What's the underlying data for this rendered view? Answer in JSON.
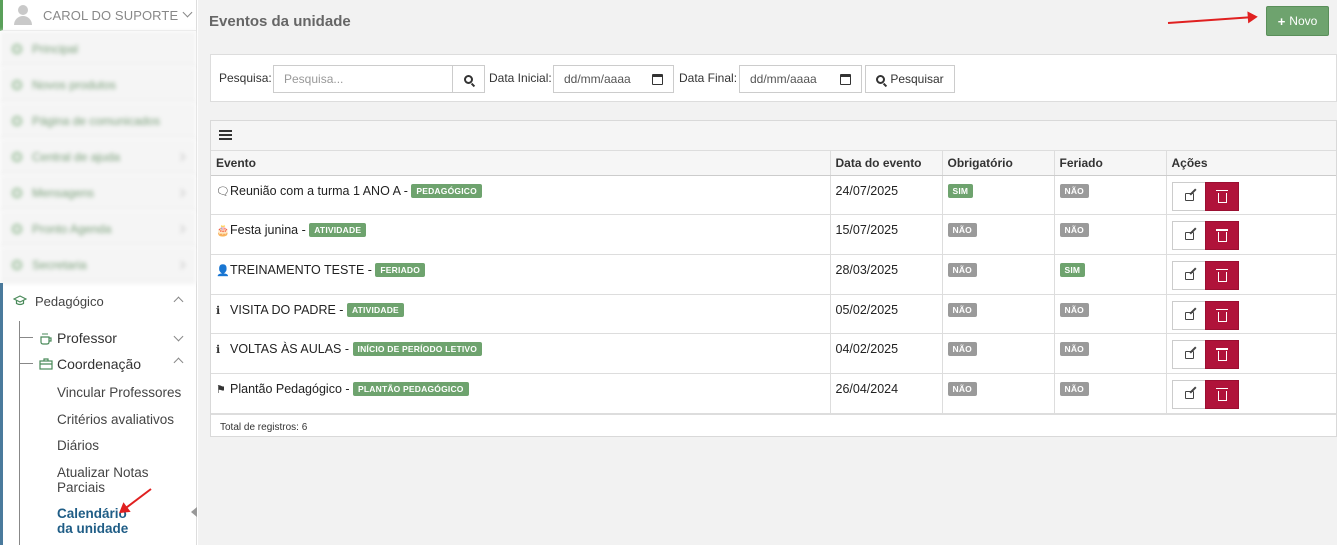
{
  "sidebar": {
    "user_name": "CAROL DO SUPORTE",
    "blurred_items": [
      "Principal",
      "Novos produtos",
      "Página de comunicados",
      "Central de ajuda",
      "Mensagens",
      "Pronto Agenda",
      "Secretaria"
    ],
    "pedagogico_label": "Pedagógico",
    "professor_label": "Professor",
    "coordenacao_label": "Coordenação",
    "links": [
      "Vincular Professores",
      "Critérios avaliativos",
      "Diários",
      "Atualizar Notas Parciais",
      "Calendário da unidade"
    ]
  },
  "header": {
    "title": "Eventos da unidade",
    "new_button": "Novo"
  },
  "search": {
    "label": "Pesquisa:",
    "placeholder": "Pesquisa...",
    "start_label": "Data Inicial:",
    "start_value": "dd/mm/aaaa",
    "end_label": "Data Final:",
    "end_value": "dd/mm/aaaa",
    "button": "Pesquisar"
  },
  "table": {
    "columns": [
      "Evento",
      "Data do evento",
      "Obrigatório",
      "Feriado",
      "Ações"
    ],
    "rows": [
      {
        "icon": "comment-icon",
        "title": "Reunião com a turma 1 ANO A -",
        "category": "PEDAGÓGICO",
        "date": "24/07/2025",
        "obrigatorio": "SIM",
        "feriado": "NÃO"
      },
      {
        "icon": "birthday-cake-icon",
        "title": "Festa junina -",
        "category": "ATIVIDADE",
        "date": "15/07/2025",
        "obrigatorio": "NÃO",
        "feriado": "NÃO"
      },
      {
        "icon": "user-icon",
        "title": "TREINAMENTO TESTE -",
        "category": "FERIADO",
        "date": "28/03/2025",
        "obrigatorio": "NÃO",
        "feriado": "SIM"
      },
      {
        "icon": "info-icon",
        "title": "VISITA DO PADRE -",
        "category": "ATIVIDADE",
        "date": "05/02/2025",
        "obrigatorio": "NÃO",
        "feriado": "NÃO"
      },
      {
        "icon": "info-icon",
        "title": "VOLTAS ÀS AULAS -",
        "category": "INÍCIO DE PERÍODO LETIVO",
        "date": "04/02/2025",
        "obrigatorio": "NÃO",
        "feriado": "NÃO"
      },
      {
        "icon": "flag-icon",
        "title": "Plantão Pedagógico -",
        "category": "PLANTÃO PEDAGÓGICO",
        "date": "26/04/2024",
        "obrigatorio": "NÃO",
        "feriado": "NÃO"
      }
    ],
    "footer": "Total de registros: 6"
  },
  "colors": {
    "green": "#6ea36e",
    "red": "#b0133a",
    "active_link": "#1f5d86",
    "annotation_arrow": "#e02020"
  }
}
